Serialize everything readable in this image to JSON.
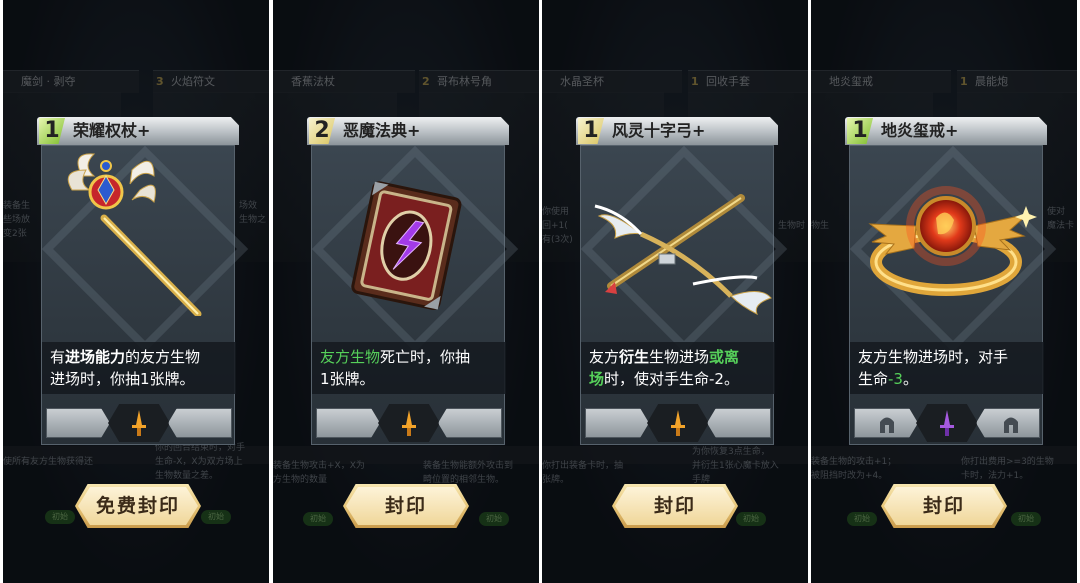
{
  "panels": [
    {
      "bg_tabs": [
        {
          "num": "",
          "label": "魔剑 · 剥夺"
        },
        {
          "num": "3",
          "label": "火焰符文"
        }
      ],
      "bg_texts": [
        "装备生",
        "些场放",
        "场效",
        "变2张",
        "生物之",
        "使所有友方生物获得还",
        "你的回合结束时，对手",
        "生命-X，X为双方场上",
        "生物数量之差。"
      ],
      "bg_badges": [
        "初始",
        "初始"
      ],
      "card": {
        "cost": "1",
        "name": "荣耀权杖+",
        "desc_parts": [
          "有",
          "进场能力",
          "的友方生物",
          "进场时，你抽1张牌。"
        ]
      },
      "button_label": "免费封印"
    },
    {
      "bg_tabs": [
        {
          "num": "",
          "label": "香蕉法杖"
        },
        {
          "num": "2",
          "label": "哥布林号角"
        }
      ],
      "bg_texts": [
        "装备生物攻击+X，X为",
        "方生物的数量",
        "装备生物能额外攻击到",
        "畸位置的相邻生物。"
      ],
      "bg_badges": [
        "初始",
        "初始"
      ],
      "card": {
        "cost": "2",
        "name": "恶魔法典+",
        "desc_parts": [
          "友方生物",
          "死亡时，你抽",
          "1张牌。"
        ]
      },
      "button_label": "封印"
    },
    {
      "bg_tabs": [
        {
          "num": "",
          "label": "水晶圣杯"
        },
        {
          "num": "1",
          "label": "回收手套"
        }
      ],
      "bg_texts": [
        "你使用",
        "回+1(",
        "生物时",
        "有(3次)",
        "为你恢复3点生命，",
        "并衍生1张心魔卡放入",
        "手牌",
        "你打出装备卡时，抽",
        "张牌。"
      ],
      "bg_badges": [
        "初始"
      ],
      "card": {
        "cost": "1",
        "name": "风灵十字弓+",
        "desc_parts": [
          "友方",
          "衍生",
          "生物进场",
          "或离",
          "场",
          "时，使对手生命-2。"
        ]
      },
      "button_label": "封印"
    },
    {
      "bg_tabs": [
        {
          "num": "",
          "label": "地炎玺戒"
        },
        {
          "num": "1",
          "label": "晨能炮"
        }
      ],
      "bg_texts": [
        "使对",
        "魔法卡",
        "物生",
        "装备生物的攻击+1；",
        "被阻挡时改为+4。",
        "你打出费用>=3的生物",
        "卡时，法力+1。"
      ],
      "bg_badges": [
        "初始",
        "初始"
      ],
      "card": {
        "cost": "1",
        "name": "地炎玺戒+",
        "desc_parts": [
          "友方生物进场时，对手",
          "生命",
          "-3",
          "。"
        ]
      },
      "button_label": "封印"
    }
  ]
}
